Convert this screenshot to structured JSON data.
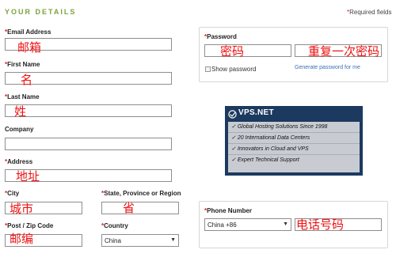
{
  "header": {
    "title": "YOUR DETAILS",
    "required_note": "Required fields"
  },
  "fields": {
    "email": {
      "label": "Email Address",
      "annotation": "邮箱"
    },
    "first_name": {
      "label": "First Name",
      "annotation": "名"
    },
    "last_name": {
      "label": "Last Name",
      "annotation": "姓"
    },
    "company": {
      "label": "Company"
    },
    "address": {
      "label": "Address",
      "annotation": "地址"
    },
    "city": {
      "label": "City",
      "annotation": "城市"
    },
    "state": {
      "label": "State, Province or Region",
      "annotation": "省"
    },
    "postcode": {
      "label": "Post / Zip Code",
      "annotation": "邮编"
    },
    "country": {
      "label": "Country",
      "value": "China"
    }
  },
  "password_panel": {
    "label": "Password",
    "password_annotation": "密码",
    "confirm_annotation": "重复一次密码",
    "show_password_label": "Show password",
    "generate_link": "Generate password for me"
  },
  "promo": {
    "brand": "VPS.NET",
    "items": [
      "Global Hosting Solutions Since 1998",
      "20 International Data Centers",
      "Innovators in Cloud and VPS",
      "Expert Technical Support"
    ],
    "check_glyph": "✓",
    "bg_color": "#1c3a5f"
  },
  "phone_panel": {
    "label": "Phone Number",
    "country_code": "China +86",
    "annotation": "电话号码"
  },
  "colors": {
    "accent": "#7aa33a",
    "required": "#dd2222",
    "annotation": "#ee1111",
    "link": "#3b6fb1"
  }
}
